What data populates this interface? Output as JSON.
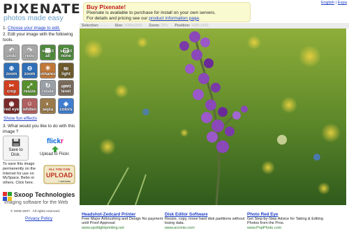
{
  "app": {
    "name": "PIXENATE",
    "tagline": "photos made easy"
  },
  "steps": {
    "step1_number": "1.",
    "step1_link": "Choose your image to edit.",
    "step2": "2. Edit your image with the following tools.",
    "step3": "3. What would you like to do with this image ?"
  },
  "tools": [
    {
      "label": "undo",
      "icon": "undo-arrow-icon",
      "color": "#a7a7a7"
    },
    {
      "label": "redo",
      "icon": "redo-arrow-icon",
      "color": "#a7a7a7"
    },
    {
      "label": "select all",
      "icon": "select-all-icon",
      "color": "#4f8a3c"
    },
    {
      "label": "select none",
      "icon": "select-none-icon",
      "color": "#4f8a3c"
    },
    {
      "label": "zoom",
      "icon": "zoom-in-icon",
      "color": "#2f6fb8"
    },
    {
      "label": "zoom",
      "icon": "zoom-out-icon",
      "color": "#2f6fb8"
    },
    {
      "label": "enhance",
      "icon": "enhance-icon",
      "color": "#c07838"
    },
    {
      "label": "fill light",
      "icon": "fill-light-icon",
      "color": "#6e5a2a"
    },
    {
      "label": "crop",
      "icon": "crop-icon",
      "color": "#d04020"
    },
    {
      "label": "resize",
      "icon": "resize-icon",
      "color": "#58902e"
    },
    {
      "label": "rotate",
      "icon": "rotate-icon",
      "color": "#9aa0a8"
    },
    {
      "label": "spirit level",
      "icon": "spirit-level-icon",
      "color": "#7a6a5a"
    },
    {
      "label": "red eye",
      "icon": "red-eye-icon",
      "color": "#7a2a2a"
    },
    {
      "label": "whiten",
      "icon": "whiten-teeth-icon",
      "color": "#b06060"
    },
    {
      "label": "sepia",
      "icon": "sepia-icon",
      "color": "#9a7a4a"
    },
    {
      "label": "colors",
      "icon": "colors-icon",
      "color": "#3f7ed0"
    }
  ],
  "fun_effects": "Show fun effects",
  "save": {
    "label": "Save to Disk.",
    "icon": "floppy-disk-icon"
  },
  "flickr": {
    "logo": "flickr",
    "label": "Upload to Flickr."
  },
  "permanent_text": "To save this image permanently on the Internet for use on MySpace, Bebo or others. Click here.",
  "upload_badge": {
    "line1": "ALL YOU CAN",
    "line2": "UPLOAD",
    "line3": "+ webstan"
  },
  "company": {
    "name": "Sxoop Technologies",
    "tagline": "Imaging software for the Web",
    "copyright": "© 2005-2007 . All rights reserved.",
    "privacy": "Privacy Policy"
  },
  "notice": {
    "title": "Buy Pixenate!",
    "line1": "Pixenate is available to purchase for install on your own servers.",
    "line2_prefix": "For details and pricing see our ",
    "line2_link": "product information page",
    "line2_suffix": "."
  },
  "languages": {
    "english": "English",
    "separator": " | ",
    "espanol": "Espa"
  },
  "infobar": {
    "selection_label": "Selection:",
    "selection_value": "---,---",
    "size_label": "Size:",
    "size_value": "3008x2000",
    "zoom_label": "Zoom:",
    "zoom_value": "25%",
    "position_label": "Position:",
    "position_value": "1680,1420"
  },
  "ads": [
    {
      "title": "Headshot-Zedcard Printer",
      "text": "Free Major Airbrushing and Design No payment until Proof Approval",
      "url": "www.spotlightprinting.net"
    },
    {
      "title": "Disk Editor Software",
      "text": "Resize, copy, move hard disk partitions without losing data.",
      "url": "www.acronis.com"
    },
    {
      "title": "Photo Red Eye",
      "text": "Get Step-by-Step Advice for Taking & Editing Photos from the Pros.",
      "url": "www.PopPhoto.com"
    }
  ],
  "colors": {
    "brand_blue": "#1a3cc8",
    "notice_title": "#c01818",
    "notice_bg": "#fafad0",
    "tagline": "#6aa0c8"
  }
}
